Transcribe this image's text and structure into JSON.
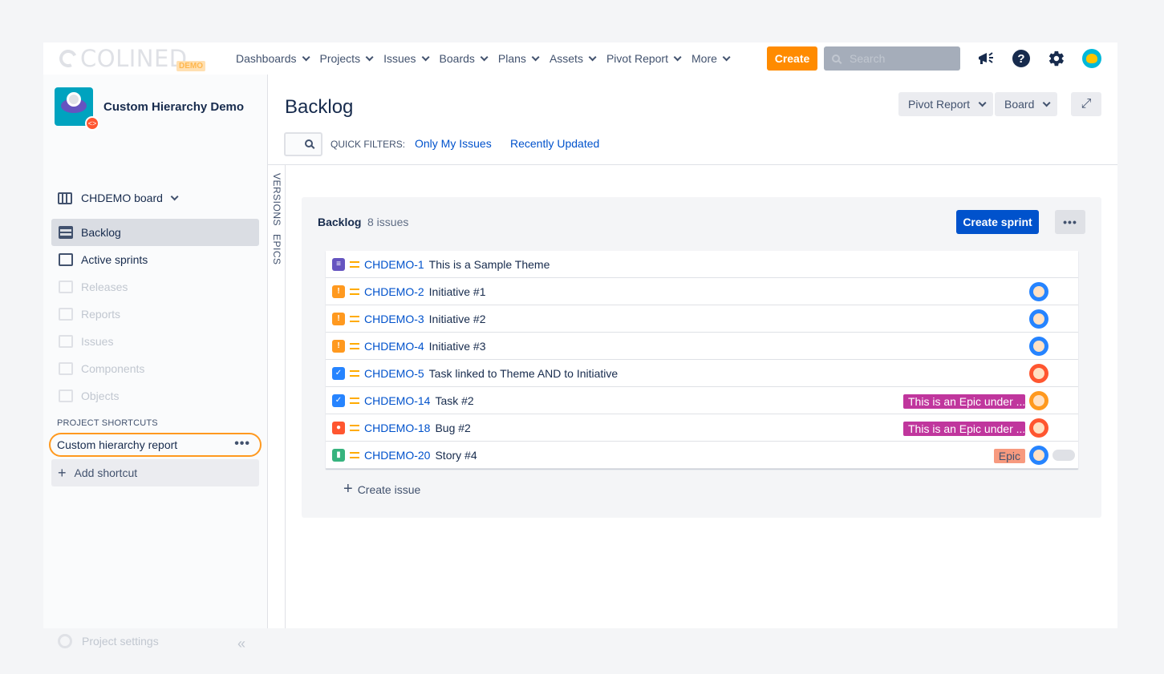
{
  "app": {
    "logo_text": "COLINED",
    "logo_badge": "DEMO",
    "nav": [
      {
        "label": "Dashboards"
      },
      {
        "label": "Projects"
      },
      {
        "label": "Issues"
      },
      {
        "label": "Boards"
      },
      {
        "label": "Plans"
      },
      {
        "label": "Assets"
      },
      {
        "label": "Pivot Report"
      },
      {
        "label": "More"
      }
    ],
    "create_label": "Create",
    "search_placeholder": "Search",
    "help_glyph": "?"
  },
  "sidebar": {
    "project_name": "Custom Hierarchy Demo",
    "board_name": "CHDEMO board",
    "items": [
      {
        "label": "Backlog",
        "icon": "backlog-icon",
        "state": "active"
      },
      {
        "label": "Active sprints",
        "icon": "board-icon",
        "state": "normal"
      },
      {
        "label": "Releases",
        "icon": "ship-icon",
        "state": "disabled"
      },
      {
        "label": "Reports",
        "icon": "chart-icon",
        "state": "disabled"
      },
      {
        "label": "Issues",
        "icon": "issues-icon",
        "state": "disabled"
      },
      {
        "label": "Components",
        "icon": "puzzle-icon",
        "state": "disabled"
      },
      {
        "label": "Objects",
        "icon": "tree-icon",
        "state": "disabled"
      }
    ],
    "shortcuts_title": "PROJECT SHORTCUTS",
    "shortcut_label": "Custom hierarchy report",
    "add_shortcut_label": "Add shortcut",
    "project_settings_label": "Project settings"
  },
  "main": {
    "title": "Backlog",
    "pivot_button": "Pivot Report",
    "board_button": "Board",
    "quick_filters_label": "QUICK FILTERS:",
    "quick_filters": [
      "Only My Issues",
      "Recently Updated"
    ],
    "vtabs": [
      "VERSIONS",
      "EPICS"
    ],
    "backlog": {
      "title": "Backlog",
      "count": "8 issues",
      "create_sprint": "Create sprint",
      "create_issue": "Create issue",
      "issues": [
        {
          "key": "CHDEMO-1",
          "summary": "This is a Sample Theme",
          "type": "theme",
          "type_color": "#6554c0",
          "lozenge": "",
          "lozenge_color": "",
          "avatar": false,
          "avatar_color": ""
        },
        {
          "key": "CHDEMO-2",
          "summary": "Initiative #1",
          "type": "initiative",
          "type_color": "#ff991f",
          "lozenge": "",
          "lozenge_color": "",
          "avatar": true,
          "avatar_color": "#2684ff"
        },
        {
          "key": "CHDEMO-3",
          "summary": "Initiative #2",
          "type": "initiative",
          "type_color": "#ff991f",
          "lozenge": "",
          "lozenge_color": "",
          "avatar": true,
          "avatar_color": "#2684ff"
        },
        {
          "key": "CHDEMO-4",
          "summary": "Initiative #3",
          "type": "initiative",
          "type_color": "#ff991f",
          "lozenge": "",
          "lozenge_color": "",
          "avatar": true,
          "avatar_color": "#2684ff"
        },
        {
          "key": "CHDEMO-5",
          "summary": "Task linked to Theme AND to Initiative",
          "type": "task",
          "type_color": "#2684ff",
          "lozenge": "",
          "lozenge_color": "",
          "avatar": true,
          "avatar_color": "#ff5630"
        },
        {
          "key": "CHDEMO-14",
          "summary": "Task #2",
          "type": "task",
          "type_color": "#2684ff",
          "lozenge": "This is an Epic under ...",
          "lozenge_color": "#c0369d",
          "avatar": true,
          "avatar_color": "#ff991f"
        },
        {
          "key": "CHDEMO-18",
          "summary": "Bug #2",
          "type": "bug",
          "type_color": "#ff5630",
          "lozenge": "This is an Epic under ...",
          "lozenge_color": "#c0369d",
          "avatar": true,
          "avatar_color": "#ff5630"
        },
        {
          "key": "CHDEMO-20",
          "summary": "Story #4",
          "type": "story",
          "type_color": "#36b37e",
          "lozenge": "Epic",
          "lozenge_color": "#f79a7f",
          "avatar": true,
          "avatar_color": "#2684ff"
        }
      ]
    }
  }
}
